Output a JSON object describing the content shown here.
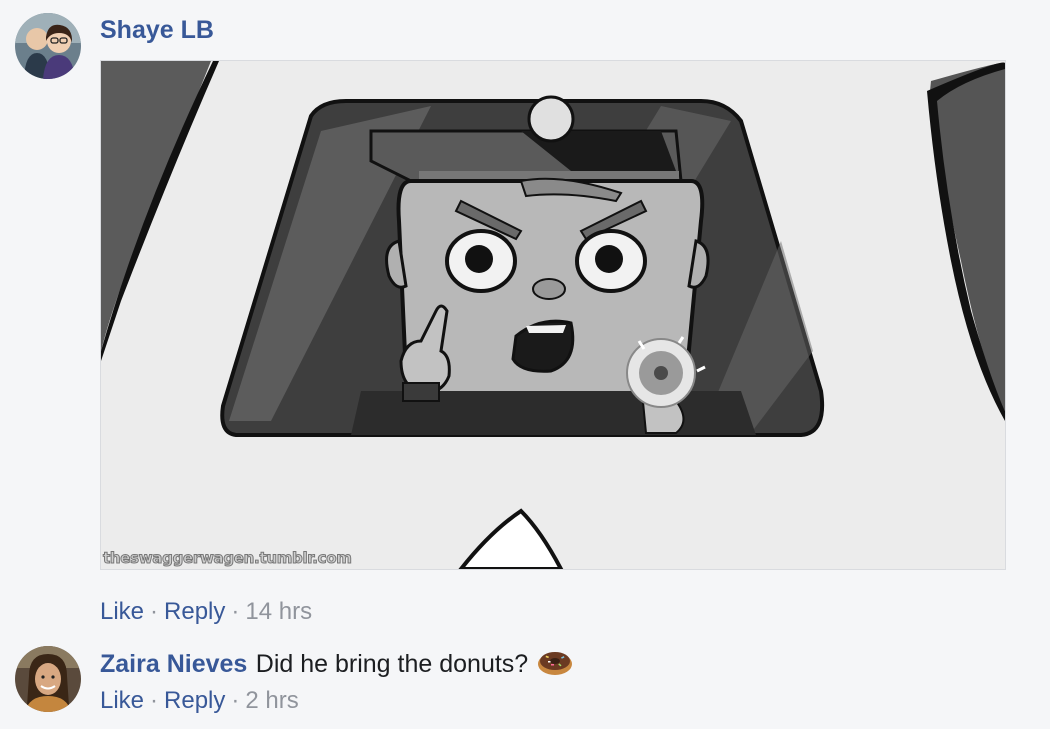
{
  "comments": [
    {
      "author": "Shaye LB",
      "text": "",
      "media": {
        "watermark": "theswaggerwagen.tumblr.com"
      },
      "actions": {
        "like": "Like",
        "reply": "Reply",
        "separator": "·",
        "time": "14 hrs"
      }
    },
    {
      "author": "Zaira Nieves",
      "text": "Did he bring the donuts?",
      "emoji": "donut-icon",
      "actions": {
        "like": "Like",
        "reply": "Reply",
        "separator": "·",
        "time": "2 hrs"
      }
    }
  ],
  "colors": {
    "author": "#385898",
    "meta": "#90949c",
    "text": "#1c1e21",
    "background": "#f5f6f8"
  }
}
